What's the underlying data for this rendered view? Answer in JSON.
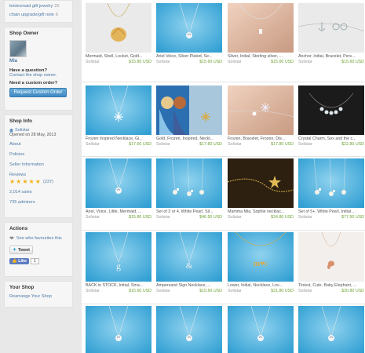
{
  "sections": [
    {
      "label": "bridesmaid gift jewelry",
      "count": "25"
    },
    {
      "label": "chain upgrade/gift note",
      "count": "6"
    }
  ],
  "owner": {
    "heading": "Shop Owner",
    "name": "Mia",
    "question": "Have a question?",
    "contact": "Contact the shop owner.",
    "custom_q": "Need a custom order?",
    "custom_btn": "Request Custom Order"
  },
  "info": {
    "heading": "Shop Info",
    "shop": "Solistar",
    "opened": "Opened on 28 May, 2013",
    "about": "About",
    "policies": "Policies",
    "seller_info": "Seller Information",
    "reviews": "Reviews",
    "rating": 5,
    "review_count": "(237)",
    "sales": "2,014 sales",
    "admirers": "735 admirers"
  },
  "actions": {
    "heading": "Actions",
    "favourite": "See who favourites this",
    "tweet": "Tweet",
    "like": "Like",
    "like_count": "1"
  },
  "your_shop": {
    "heading": "Your Shop",
    "rearrange": "Rearrange Your Shop"
  },
  "colors": {
    "price": "#6ca233",
    "link": "#4d7aa8",
    "button": "#3f88c2"
  },
  "items": [
    {
      "title": "Mermaid, Shell, Locket, Gold...",
      "shop": "Solistar",
      "price": "$15.80 USD",
      "icon": "shell-necklace"
    },
    {
      "title": "Ariel Voice, Silver Plated, Se...",
      "shop": "Solistar",
      "price": "$15.60 USD",
      "icon": "shell-necklace"
    },
    {
      "title": "Silver, Initial, Sterling silver, ...",
      "shop": "Solistar",
      "price": "$15.60 USD",
      "icon": "initial-necklace"
    },
    {
      "title": "Anchor, Initial, Bracelet, Pers...",
      "shop": "Solistar",
      "price": "$15.60 USD",
      "icon": "anchor-bracelet"
    },
    {
      "title": "Frozen Inspired Necklace, Gi...",
      "shop": "Solistar",
      "price": "$17.60 USD",
      "icon": "snowflake-necklace"
    },
    {
      "title": "Gold, Frozen, Inspired, Neckl...",
      "shop": "Solistar",
      "price": "$17.80 USD",
      "icon": "frozen-poster"
    },
    {
      "title": "Frozen, Bracelet, Frozen, Dis...",
      "shop": "Solistar",
      "price": "$17.80 USD",
      "icon": "snowflake-bracelet"
    },
    {
      "title": "Crystal Charm, Sex and the c...",
      "shop": "Solistar",
      "price": "$22.80 USD",
      "icon": "crystal-necklace"
    },
    {
      "title": "Ariel, Voice, Little, Mermaid, ...",
      "shop": "Solistar",
      "price": "$15.80 USD",
      "icon": "shell-necklace"
    },
    {
      "title": "Set of 3 or 4, White Pearl, Sil...",
      "shop": "Solistar",
      "price": "$46.50 USD",
      "icon": "pearl-set"
    },
    {
      "title": "Mamma Mia, Sophie necklac...",
      "shop": "Solistar",
      "price": "$24.80 USD",
      "icon": "star-necklace"
    },
    {
      "title": "Set of 5+, White Pearl, Initial ...",
      "shop": "Solistar",
      "price": "$77.50 USD",
      "icon": "pearl-set"
    },
    {
      "title": "BACK in STOCK, Initial, Sma...",
      "shop": "Solistar",
      "price": "$15.60 USD",
      "icon": "letter-g-necklace"
    },
    {
      "title": "Ampersand Sign Necklace, ...",
      "shop": "Solistar",
      "price": "$15.60 USD",
      "icon": "ampersand-necklace"
    },
    {
      "title": "Lower, Initial, Necklace, Lov...",
      "shop": "Solistar",
      "price": "$21.80 USD",
      "icon": "letters-necklace"
    },
    {
      "title": "Tiniest, Cute, Baby Elephant, ...",
      "shop": "Solistar",
      "price": "$20.80 USD",
      "icon": "elephant-necklace"
    },
    {
      "title": "",
      "shop": "",
      "price": "",
      "icon": "shell-necklace"
    },
    {
      "title": "",
      "shop": "",
      "price": "",
      "icon": "shell-necklace"
    },
    {
      "title": "",
      "shop": "",
      "price": "",
      "icon": "shell-necklace"
    },
    {
      "title": "",
      "shop": "",
      "price": "",
      "icon": "shell-necklace"
    }
  ]
}
